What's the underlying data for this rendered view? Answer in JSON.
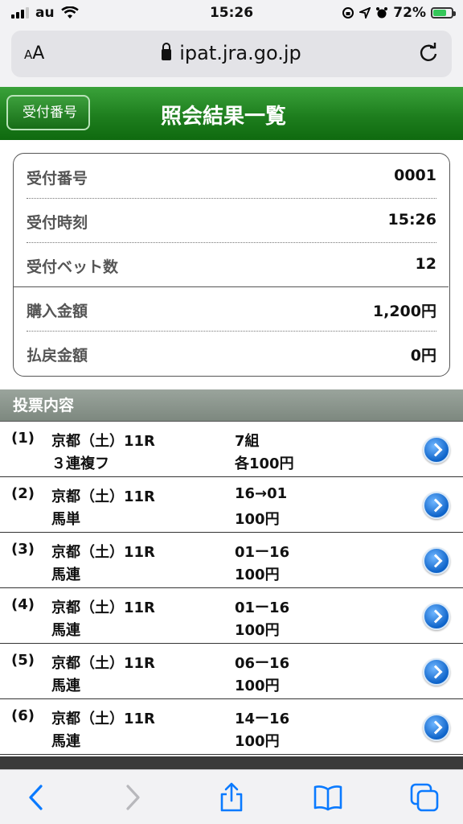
{
  "status_bar": {
    "carrier": "au",
    "time": "15:26",
    "battery_percent": "72%",
    "battery_level": 0.72,
    "signal_icon": "signal-icon",
    "wifi_icon": "wifi-icon",
    "accent_battery": "#34c759"
  },
  "browser": {
    "text_size_label_small": "A",
    "text_size_label_large": "A",
    "url": "ipat.jra.go.jp",
    "lock_icon": "lock-icon",
    "reload_icon": "reload-icon"
  },
  "header": {
    "back_label": "受付番号",
    "title": "照会結果一覧",
    "color": "#1e7e1e"
  },
  "summary": {
    "rows": [
      {
        "label": "受付番号",
        "value": "0001"
      },
      {
        "label": "受付時刻",
        "value": "15:26"
      },
      {
        "label": "受付ベット数",
        "value": "12"
      },
      {
        "label": "購入金額",
        "value": "1,200円"
      },
      {
        "label": "払戻金額",
        "value": "0円"
      }
    ]
  },
  "section": {
    "title": "投票内容"
  },
  "tickets": [
    {
      "num": "(1)",
      "race": "京都（土）11R",
      "type": "３連複フ",
      "combo": "7組",
      "amount": "各100円"
    },
    {
      "num": "(2)",
      "race": "京都（土）11R",
      "type": "馬単",
      "combo": "16→01",
      "amount": "100円"
    },
    {
      "num": "(3)",
      "race": "京都（土）11R",
      "type": "馬連",
      "combo": "01ー16",
      "amount": "100円"
    },
    {
      "num": "(4)",
      "race": "京都（土）11R",
      "type": "馬連",
      "combo": "01ー16",
      "amount": "100円"
    },
    {
      "num": "(5)",
      "race": "京都（土）11R",
      "type": "馬連",
      "combo": "06ー16",
      "amount": "100円"
    },
    {
      "num": "(6)",
      "race": "京都（土）11R",
      "type": "馬連",
      "combo": "14ー16",
      "amount": "100円"
    }
  ],
  "toolbar": {
    "back_icon": "back-arrow-icon",
    "forward_icon": "forward-arrow-icon",
    "share_icon": "share-icon",
    "bookmarks_icon": "bookmarks-icon",
    "tabs_icon": "tabs-icon",
    "accent": "#0a7aff"
  }
}
